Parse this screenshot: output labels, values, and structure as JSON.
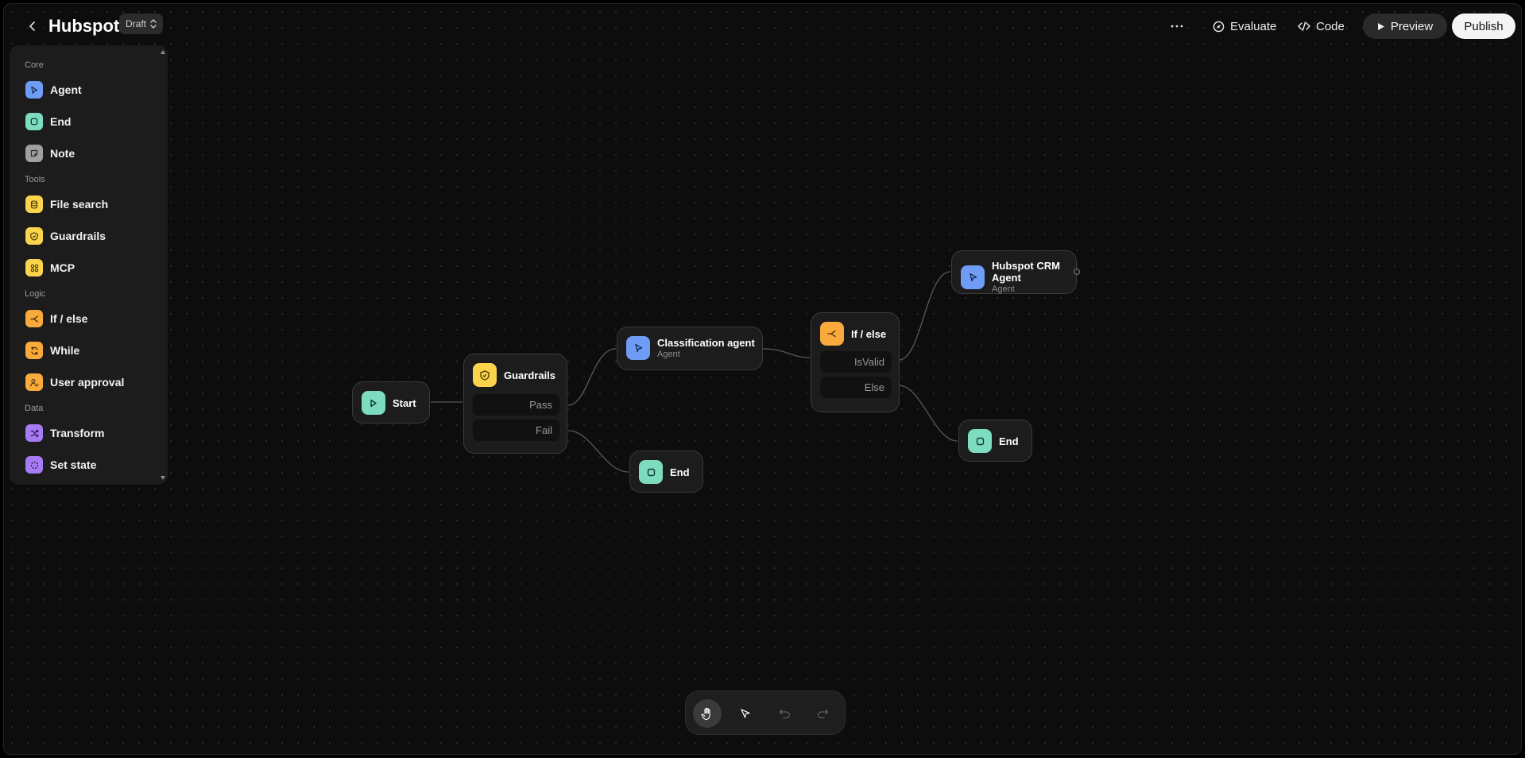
{
  "header": {
    "title": "Hubspot",
    "badge": "Draft",
    "more_icon": "more-horizontal-icon",
    "evaluate_label": "Evaluate",
    "code_label": "Code",
    "preview_label": "Preview",
    "publish_label": "Publish"
  },
  "sidebar": {
    "sections": [
      {
        "label": "Core",
        "items": [
          {
            "label": "Agent",
            "icon": "agent-icon",
            "color": "#6f9cf5"
          },
          {
            "label": "End",
            "icon": "end-icon",
            "color": "#7ddcc0"
          },
          {
            "label": "Note",
            "icon": "note-icon",
            "color": "#a0a0a0"
          }
        ]
      },
      {
        "label": "Tools",
        "items": [
          {
            "label": "File search",
            "icon": "file-search-icon",
            "color": "#fcd34d"
          },
          {
            "label": "Guardrails",
            "icon": "guardrails-icon",
            "color": "#fcd34d"
          },
          {
            "label": "MCP",
            "icon": "mcp-icon",
            "color": "#fcd34d"
          }
        ]
      },
      {
        "label": "Logic",
        "items": [
          {
            "label": "If / else",
            "icon": "branch-icon",
            "color": "#f8ab3c"
          },
          {
            "label": "While",
            "icon": "loop-icon",
            "color": "#f8ab3c"
          },
          {
            "label": "User approval",
            "icon": "user-approval-icon",
            "color": "#f8ab3c"
          }
        ]
      },
      {
        "label": "Data",
        "items": [
          {
            "label": "Transform",
            "icon": "transform-icon",
            "color": "#a67cf5"
          },
          {
            "label": "Set state",
            "icon": "set-state-icon",
            "color": "#a67cf5"
          }
        ]
      }
    ]
  },
  "canvas": {
    "nodes": {
      "start": {
        "title": "Start",
        "color": "#7ddcc0"
      },
      "guardrails": {
        "title": "Guardrails",
        "color": "#fcd34d",
        "branches": [
          "Pass",
          "Fail"
        ]
      },
      "end_guardrails": {
        "title": "End",
        "color": "#7ddcc0"
      },
      "classification": {
        "title": "Classification agent",
        "subtitle": "Agent",
        "color": "#6f9cf5"
      },
      "ifelse": {
        "title": "If / else",
        "color": "#f8ab3c",
        "branches": [
          "IsValid",
          "Else"
        ]
      },
      "hubspot_agent": {
        "title": "Hubspot CRM Agent",
        "subtitle": "Agent",
        "color": "#6f9cf5"
      },
      "end_else": {
        "title": "End",
        "color": "#7ddcc0"
      }
    }
  },
  "toolbar": {
    "tools": [
      {
        "icon": "hand-icon",
        "active": true
      },
      {
        "icon": "pointer-icon",
        "active": false
      },
      {
        "icon": "undo-icon",
        "active": false
      },
      {
        "icon": "redo-icon",
        "active": false
      }
    ]
  }
}
